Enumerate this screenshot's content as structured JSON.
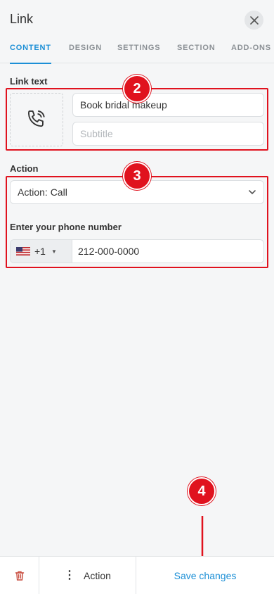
{
  "header": {
    "title": "Link"
  },
  "tabs": [
    {
      "label": "CONTENT"
    },
    {
      "label": "DESIGN"
    },
    {
      "label": "SETTINGS"
    },
    {
      "label": "SECTION"
    },
    {
      "label": "ADD-ONS"
    }
  ],
  "link_text": {
    "label": "Link text",
    "title_value": "Book bridal makeup",
    "subtitle_placeholder": "Subtitle",
    "icon": "phone-ringing-icon"
  },
  "action": {
    "label": "Action",
    "selected": "Action: Call"
  },
  "phone": {
    "label": "Enter your phone number",
    "country_code": "+1",
    "country_flag": "us-flag-icon",
    "number": "212-000-0000"
  },
  "annotations": {
    "badge_2": "2",
    "badge_3": "3",
    "badge_4": "4"
  },
  "footer": {
    "action_label": "Action",
    "save_label": "Save changes"
  },
  "colors": {
    "accent": "#1c8fd6",
    "annotation": "#e0121e"
  }
}
